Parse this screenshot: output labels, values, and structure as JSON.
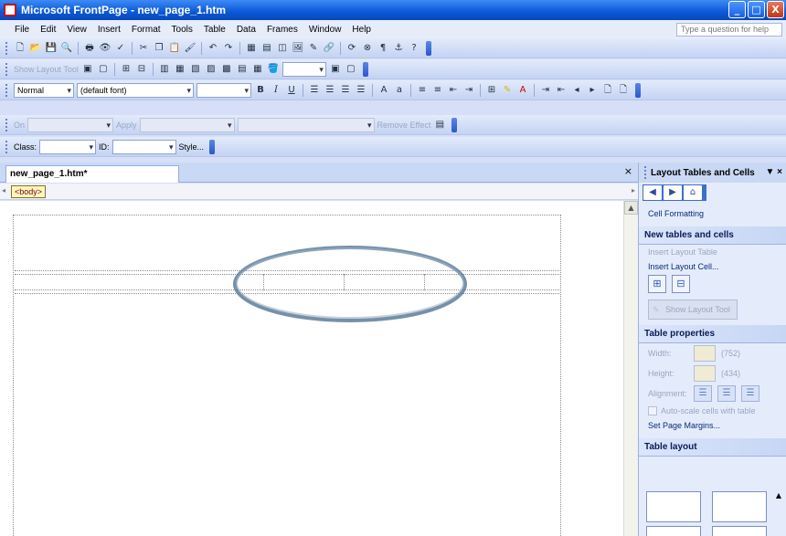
{
  "window": {
    "title": "Microsoft FrontPage - new_page_1.htm",
    "min": "_",
    "max": "□",
    "close": "X"
  },
  "menu": {
    "items": [
      "File",
      "Edit",
      "View",
      "Insert",
      "Format",
      "Tools",
      "Table",
      "Data",
      "Frames",
      "Window",
      "Help"
    ],
    "help_placeholder": "Type a question for help"
  },
  "toolbar_layout": {
    "show_layout_tool": "Show Layout Tool"
  },
  "toolbar_format": {
    "style": "Normal",
    "font": "(default font)",
    "bold": "B",
    "italic": "I",
    "underline": "U"
  },
  "toolbar_dhtml": {
    "on": "On",
    "apply": "Apply",
    "remove_effect": "Remove Effect"
  },
  "toolbar_tag": {
    "class_label": "Class:",
    "id_label": "ID:",
    "style_button": "Style..."
  },
  "document": {
    "tab": "new_page_1.htm*",
    "close": "×",
    "quick_tag": "<body>"
  },
  "taskpane": {
    "title": "Layout Tables and Cells",
    "menu_arrow": "▼",
    "close": "×",
    "cell_formatting": "Cell Formatting",
    "section_new": "New tables and cells",
    "insert_layout_table": "Insert Layout Table",
    "insert_layout_cell": "Insert Layout Cell...",
    "show_layout_tool": "Show Layout Tool",
    "section_props": "Table properties",
    "width_label": "Width:",
    "width_value": "(752)",
    "height_label": "Height:",
    "height_value": "(434)",
    "alignment_label": "Alignment:",
    "autoscale": "Auto-scale cells with table",
    "set_margins": "Set Page Margins...",
    "section_layout": "Table layout"
  }
}
